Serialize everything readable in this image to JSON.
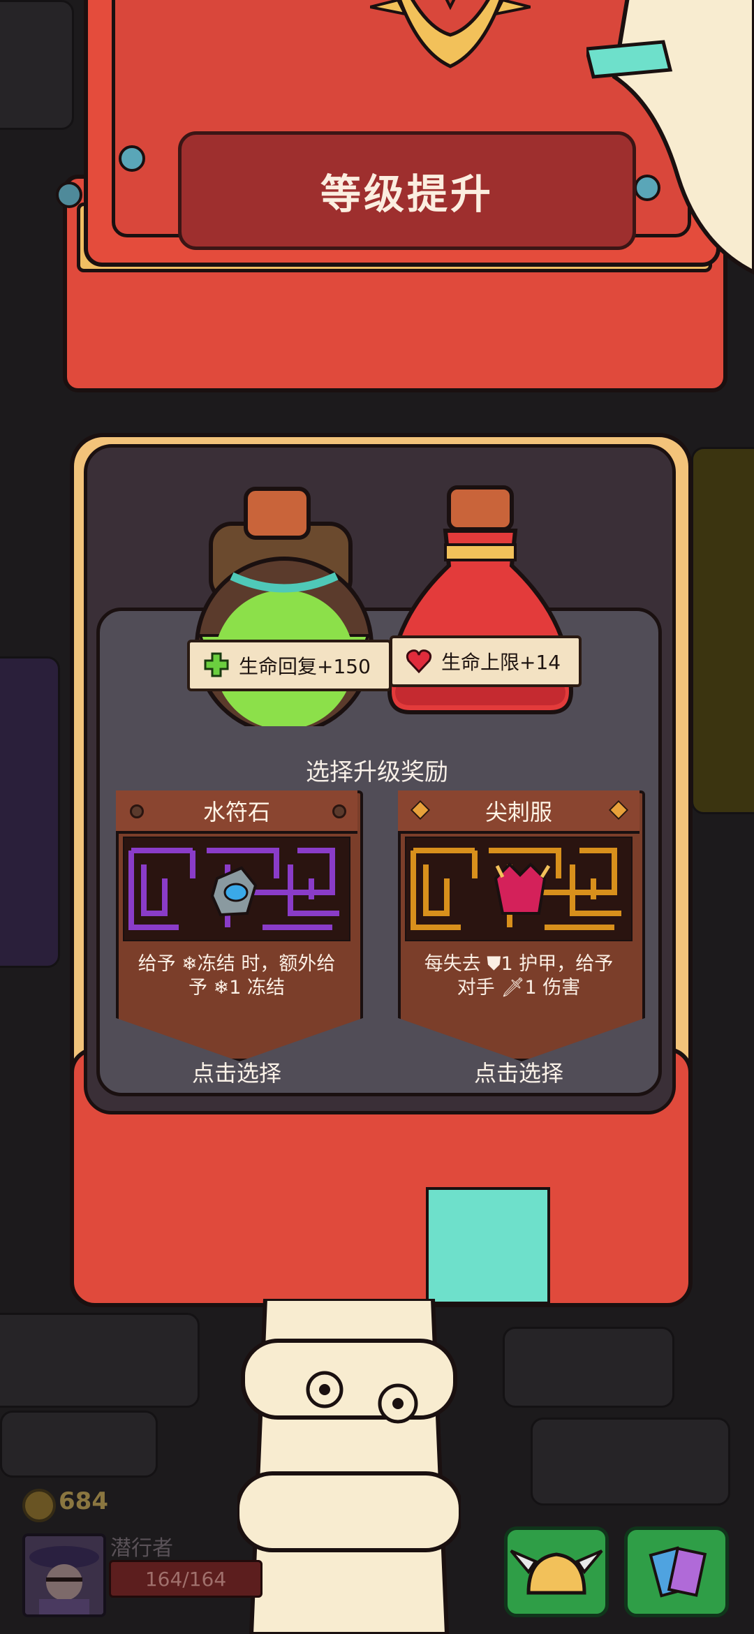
{
  "header": {
    "title": "等级提升"
  },
  "potions": {
    "left": {
      "label": "生命回复+150",
      "icon": "plus-icon"
    },
    "right": {
      "label": "生命上限+14",
      "icon": "heart-icon"
    }
  },
  "rewards": {
    "title": "选择升级奖励",
    "items": [
      {
        "name": "水符石",
        "desc_line1": "给予 ❄冻结 时，额外给",
        "desc_line2": "予 ❄1 冻结",
        "action": "点击选择",
        "maze_color": "#8a3cc8"
      },
      {
        "name": "尖刺服",
        "desc_line1": "每失去 ⛊1 护甲，给予",
        "desc_line2": "对手 🗡1 伤害",
        "action": "点击选择",
        "maze_color": "#d8901c"
      }
    ]
  },
  "hud": {
    "coins": "684",
    "hero_name": "潜行者",
    "hp": "164/164"
  }
}
